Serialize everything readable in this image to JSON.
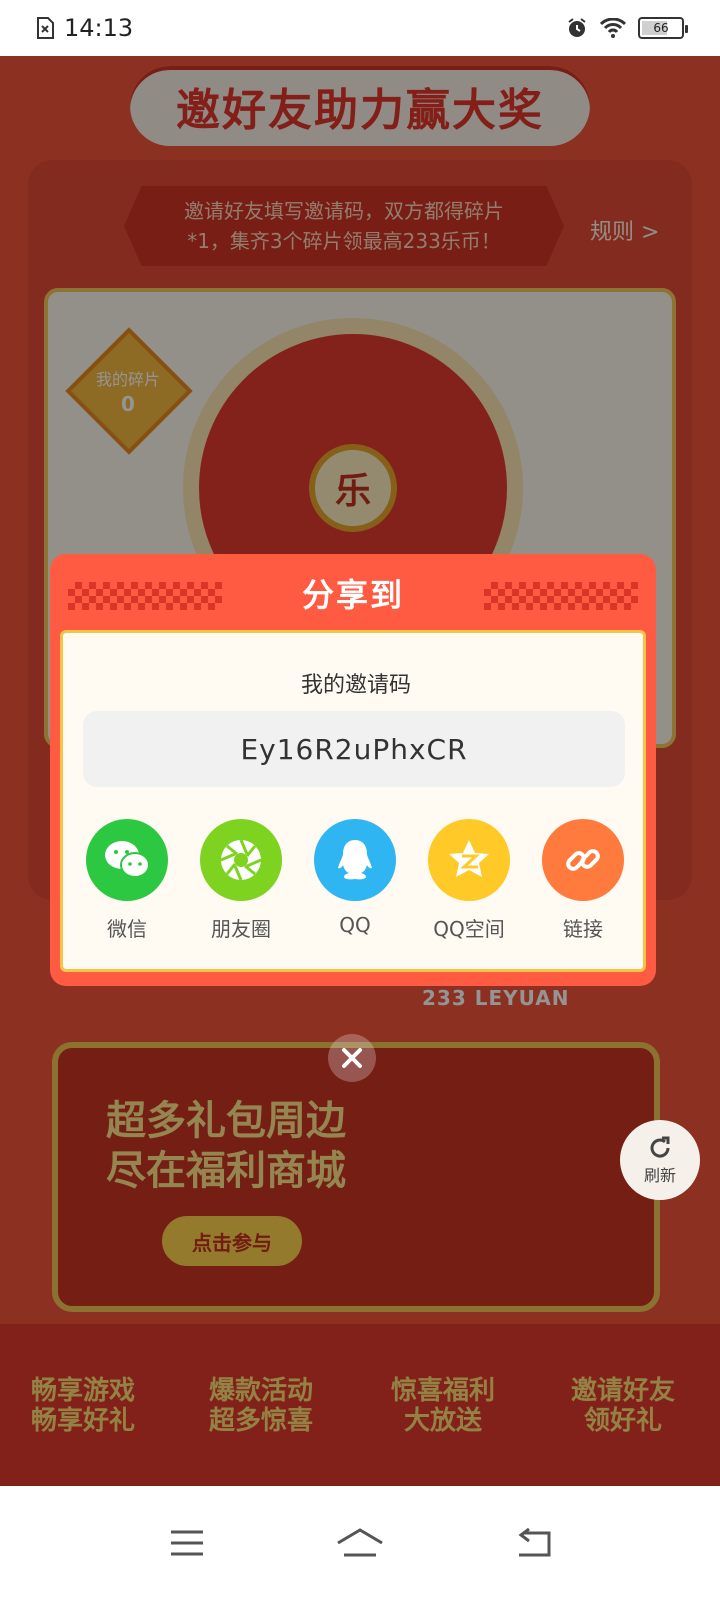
{
  "status_bar": {
    "time": "14:13",
    "battery": "66",
    "battery_level": 0.66
  },
  "background_page": {
    "title": "邀好友助力赢大奖",
    "info_line1": "邀请好友填写邀请码，双方都得碎片",
    "info_line2": "*1，集齐3个碎片领最高233乐币！",
    "rules_link": "规则 >",
    "fragment_label": "我的碎片",
    "fragment_count": "0",
    "wheel_center": "乐",
    "site_label": "233 LEYUAN",
    "banner_line1": "超多礼包周边",
    "banner_line2": "尽在福利商城",
    "banner_button": "点击参与",
    "features": [
      {
        "line1": "畅享游戏",
        "line2": "畅享好礼"
      },
      {
        "line1": "爆款活动",
        "line2": "超多惊喜"
      },
      {
        "line1": "惊喜福利",
        "line2": "大放送"
      },
      {
        "line1": "邀请好友",
        "line2": "领好礼"
      }
    ]
  },
  "dialog": {
    "title": "分享到",
    "code_label": "我的邀请码",
    "invite_code": "Ey16R2uPhxCR",
    "share_targets": [
      {
        "label": "微信",
        "icon": "wechat-icon",
        "color": "#2dc841"
      },
      {
        "label": "朋友圈",
        "icon": "moments-icon",
        "color": "#7ed321"
      },
      {
        "label": "QQ",
        "icon": "qq-icon",
        "color": "#2eb5f2"
      },
      {
        "label": "QQ空间",
        "icon": "qzone-icon",
        "color": "#ffc928"
      },
      {
        "label": "链接",
        "icon": "link-icon",
        "color": "#ff7a3d"
      }
    ]
  },
  "refresh_label": "刷新",
  "colors": {
    "dialog_bg": "#ff5b43",
    "dialog_border": "#f5c346",
    "page_bg": "#f2543c"
  }
}
